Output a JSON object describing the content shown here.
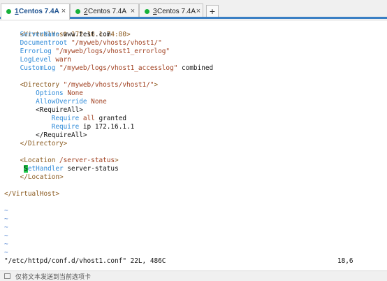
{
  "tabs": [
    {
      "num": "1",
      "title": "Centos 7.4A",
      "close": "×",
      "status_color": "#17b13a"
    },
    {
      "num": "2",
      "title": "Centos 7.4A",
      "close": "×",
      "status_color": "#17b13a"
    },
    {
      "num": "3",
      "title": "Centos 7.4A",
      "close": "×",
      "status_color": "#17b13a"
    }
  ],
  "new_tab_label": "+",
  "editor": {
    "l1": {
      "a": "<VirtualHost 172.16.1.74:80>"
    },
    "l2": {
      "a": "    ServerName",
      "b": " www.test.com"
    },
    "l3": {
      "a": "    Documentroot",
      "b": " \"/myweb/vhosts/vhost1/\""
    },
    "l4": {
      "a": "    ErrorLog",
      "b": " \"/myweb/logs/vhost1_errorlog\""
    },
    "l5": {
      "a": "    LogLevel",
      "b": " warn"
    },
    "l6": {
      "a": "    CustomLog",
      "b": " \"/myweb/logs/vhost1_accesslog\"",
      "c": " combined"
    },
    "l8": {
      "a": "    <Directory",
      "b": " \"/myweb/vhosts/vhost1/\"",
      "c": ">"
    },
    "l9": {
      "a": "        Options",
      "b": " None"
    },
    "l10": {
      "a": "        AllowOverride",
      "b": " None"
    },
    "l11": {
      "a": "        <RequireAll>"
    },
    "l12": {
      "a": "            Require",
      "b": " all",
      "c": " granted"
    },
    "l13": {
      "a": "            Require",
      "b": " ip 172.16.1.1"
    },
    "l14": {
      "a": "        </RequireAll>"
    },
    "l15": {
      "a": "    </Directory>"
    },
    "l17": {
      "a": "    <Location",
      "b": " /server-status",
      "c": ">"
    },
    "l18": {
      "pad": "     ",
      "cur": "S",
      "a": "etHandler",
      "b": " server-status"
    },
    "l19": {
      "a": "    </Location>"
    },
    "l21": {
      "a": "</VirtualHost>"
    },
    "tilde": "~"
  },
  "status": {
    "file_info": "\"/etc/httpd/conf.d/vhost1.conf\" 22L, 486C",
    "cursor_pos": "18,6"
  },
  "hint_bar": {
    "text": "仅将文本发送到当前选项卡"
  },
  "colors": {
    "tag": "#8a5a1f",
    "keyword": "#2e8ad8",
    "string": "#a04020",
    "cursor": "#1fc94b",
    "tilde": "#4a7fd0",
    "tab_accent": "#3a7fc4"
  }
}
